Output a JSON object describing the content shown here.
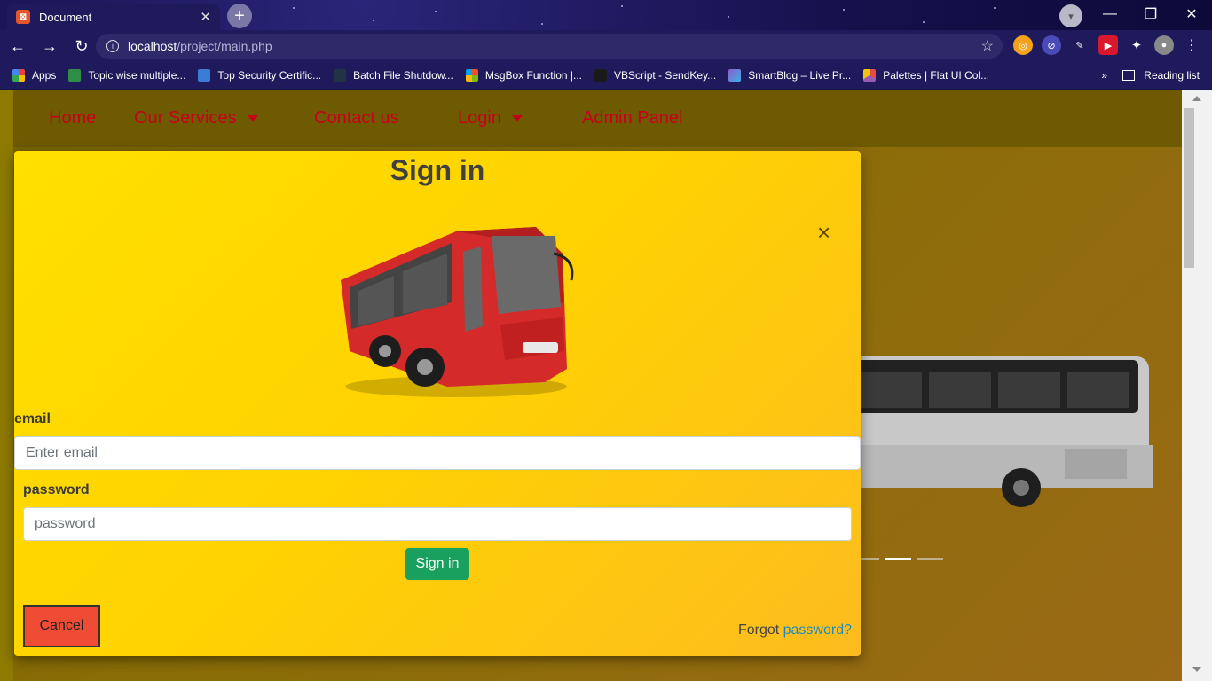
{
  "browser": {
    "tab_title": "Document",
    "tab_close": "✕",
    "new_tab": "+",
    "url_host": "localhost",
    "url_path": "/project/main.php",
    "window_controls": [
      "—",
      "❐",
      "✕"
    ]
  },
  "bookmarks": {
    "items": [
      {
        "label": "Apps",
        "color": "#ea4335"
      },
      {
        "label": "Topic wise multiple...",
        "color": "#2f8d46"
      },
      {
        "label": "Top Security Certific...",
        "color": "#3a7bd5"
      },
      {
        "label": "Batch File Shutdow...",
        "color": "#223344"
      },
      {
        "label": "MsgBox Function |...",
        "color": "#f25022"
      },
      {
        "label": "VBScript - SendKey...",
        "color": "#1a1a1a"
      },
      {
        "label": "SmartBlog – Live Pr...",
        "color": "#8e5cc9"
      },
      {
        "label": "Palettes | Flat UI Col...",
        "color": "#e74c3c"
      }
    ],
    "overflow": "»",
    "reading_list": "Reading list"
  },
  "navbar": {
    "home": "Home",
    "services": "Our Services",
    "contact": "Contact us",
    "login": "Login",
    "admin": "Admin Panel"
  },
  "modal": {
    "title": "Sign in",
    "close": "×",
    "email_label": "email",
    "email_placeholder": "Enter email",
    "password_label": "password",
    "password_placeholder": "password",
    "signin_button": "Sign in",
    "cancel_button": "Cancel",
    "forgot_text": "Forgot ",
    "forgot_link": "password?"
  },
  "carousel": {
    "active_index": 1,
    "count": 3
  },
  "colors": {
    "nav_link": "#c9001c",
    "modal_bg": "#ffd300",
    "signin": "#19a05f",
    "cancel": "#f04b35",
    "link": "#1f8ac0"
  }
}
